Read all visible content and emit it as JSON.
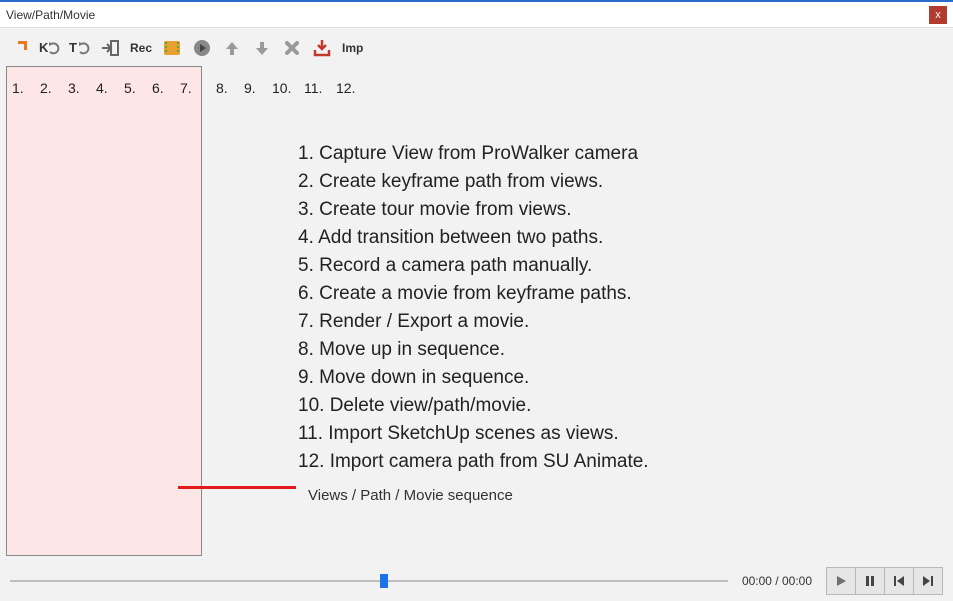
{
  "window": {
    "title": "View/Path/Movie",
    "close_label": "x"
  },
  "toolbar": {
    "rec_label": "Rec",
    "imp_label": "Imp"
  },
  "numbers": {
    "n1": "1.",
    "n2": "2.",
    "n3": "3.",
    "n4": "4.",
    "n5": "5.",
    "n6": "6.",
    "n7": "7.",
    "n8": "8.",
    "n9": "9.",
    "n10": "10.",
    "n11": "11.",
    "n12": "12."
  },
  "help": {
    "i1": "1. Capture View from ProWalker camera",
    "i2": "2. Create keyframe path from views.",
    "i3": "3. Create tour movie from views.",
    "i4": "4. Add transition between two paths.",
    "i5": "5. Record a camera path manually.",
    "i6": "6. Create a movie from keyframe paths.",
    "i7": "7. Render / Export a movie.",
    "i8": "8. Move up in sequence.",
    "i9": "9. Move down in sequence.",
    "i10": "10. Delete view/path/movie.",
    "i11": "11. Import SketchUp scenes as views.",
    "i12": "12. Import camera path from SU Animate."
  },
  "sequence_label": "Views / Path / Movie sequence",
  "playback": {
    "time": "00:00 / 00:00"
  }
}
